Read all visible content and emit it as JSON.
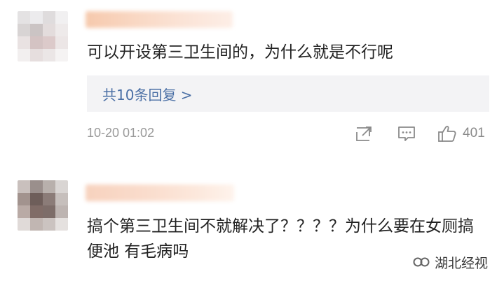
{
  "comments": [
    {
      "text": "可以开设第三卫生间的，为什么就是不行呢",
      "replies_label": "共10条回复 >",
      "timestamp": "10-20 01:02",
      "like_count": "401",
      "actions": [
        "share-icon",
        "comment-icon",
        "like-icon"
      ]
    },
    {
      "text": "搞个第三卫生间不就解决了？？？？为什么要在女厕搞便池 有毛病吗"
    }
  ],
  "watermark": {
    "label": "湖北经视",
    "icon": "wechat-channel-icon"
  },
  "colors": {
    "text": "#222222",
    "link": "#4a6fa5",
    "meta": "#9a9a9a",
    "reply_bg": "#f3f3f5"
  }
}
